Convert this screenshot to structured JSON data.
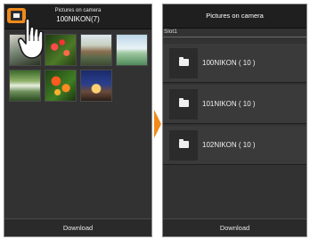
{
  "left_screen": {
    "header_title": "Pictures on camera",
    "folder_label": "100NIKON(7)",
    "back_icon": "folder-back-icon",
    "thumbnails": [
      {
        "name": "photo-thumbnail"
      },
      {
        "name": "photo-thumbnail"
      },
      {
        "name": "photo-thumbnail"
      },
      {
        "name": "photo-thumbnail"
      },
      {
        "name": "photo-thumbnail"
      },
      {
        "name": "photo-thumbnail"
      },
      {
        "name": "photo-thumbnail"
      }
    ],
    "download_label": "Download"
  },
  "right_screen": {
    "header_title": "Pictures on camera",
    "slot_label": "Slot1",
    "folders": [
      {
        "label": "100NIKON ( 10 )",
        "icon": "folder-icon"
      },
      {
        "label": "101NIKON ( 10 )",
        "icon": "folder-icon"
      },
      {
        "label": "102NIKON ( 10 )",
        "icon": "folder-icon"
      }
    ],
    "download_label": "Download"
  },
  "colors": {
    "accent": "#f08a1a",
    "screen_bg": "#323232",
    "header_bg": "#1f1f1f"
  }
}
